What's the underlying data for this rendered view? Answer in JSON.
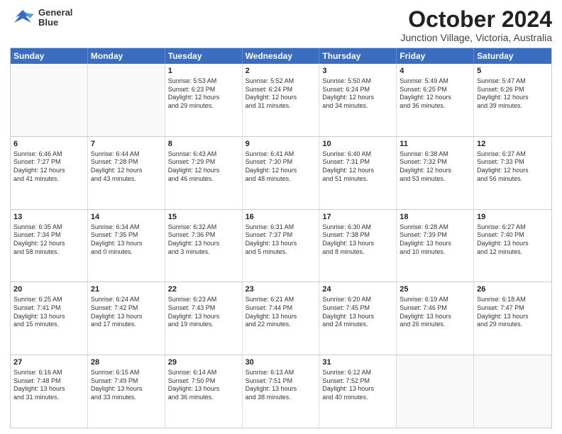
{
  "header": {
    "logo": {
      "line1": "General",
      "line2": "Blue"
    },
    "title": "October 2024",
    "subtitle": "Junction Village, Victoria, Australia"
  },
  "days_of_week": [
    "Sunday",
    "Monday",
    "Tuesday",
    "Wednesday",
    "Thursday",
    "Friday",
    "Saturday"
  ],
  "weeks": [
    [
      {
        "day": "",
        "info": ""
      },
      {
        "day": "",
        "info": ""
      },
      {
        "day": "1",
        "info": "Sunrise: 5:53 AM\nSunset: 6:23 PM\nDaylight: 12 hours\nand 29 minutes."
      },
      {
        "day": "2",
        "info": "Sunrise: 5:52 AM\nSunset: 6:24 PM\nDaylight: 12 hours\nand 31 minutes."
      },
      {
        "day": "3",
        "info": "Sunrise: 5:50 AM\nSunset: 6:24 PM\nDaylight: 12 hours\nand 34 minutes."
      },
      {
        "day": "4",
        "info": "Sunrise: 5:49 AM\nSunset: 6:25 PM\nDaylight: 12 hours\nand 36 minutes."
      },
      {
        "day": "5",
        "info": "Sunrise: 5:47 AM\nSunset: 6:26 PM\nDaylight: 12 hours\nand 39 minutes."
      }
    ],
    [
      {
        "day": "6",
        "info": "Sunrise: 6:46 AM\nSunset: 7:27 PM\nDaylight: 12 hours\nand 41 minutes."
      },
      {
        "day": "7",
        "info": "Sunrise: 6:44 AM\nSunset: 7:28 PM\nDaylight: 12 hours\nand 43 minutes."
      },
      {
        "day": "8",
        "info": "Sunrise: 6:43 AM\nSunset: 7:29 PM\nDaylight: 12 hours\nand 46 minutes."
      },
      {
        "day": "9",
        "info": "Sunrise: 6:41 AM\nSunset: 7:30 PM\nDaylight: 12 hours\nand 48 minutes."
      },
      {
        "day": "10",
        "info": "Sunrise: 6:40 AM\nSunset: 7:31 PM\nDaylight: 12 hours\nand 51 minutes."
      },
      {
        "day": "11",
        "info": "Sunrise: 6:38 AM\nSunset: 7:32 PM\nDaylight: 12 hours\nand 53 minutes."
      },
      {
        "day": "12",
        "info": "Sunrise: 6:37 AM\nSunset: 7:33 PM\nDaylight: 12 hours\nand 56 minutes."
      }
    ],
    [
      {
        "day": "13",
        "info": "Sunrise: 6:35 AM\nSunset: 7:34 PM\nDaylight: 12 hours\nand 58 minutes."
      },
      {
        "day": "14",
        "info": "Sunrise: 6:34 AM\nSunset: 7:35 PM\nDaylight: 13 hours\nand 0 minutes."
      },
      {
        "day": "15",
        "info": "Sunrise: 6:32 AM\nSunset: 7:36 PM\nDaylight: 13 hours\nand 3 minutes."
      },
      {
        "day": "16",
        "info": "Sunrise: 6:31 AM\nSunset: 7:37 PM\nDaylight: 13 hours\nand 5 minutes."
      },
      {
        "day": "17",
        "info": "Sunrise: 6:30 AM\nSunset: 7:38 PM\nDaylight: 13 hours\nand 8 minutes."
      },
      {
        "day": "18",
        "info": "Sunrise: 6:28 AM\nSunset: 7:39 PM\nDaylight: 13 hours\nand 10 minutes."
      },
      {
        "day": "19",
        "info": "Sunrise: 6:27 AM\nSunset: 7:40 PM\nDaylight: 13 hours\nand 12 minutes."
      }
    ],
    [
      {
        "day": "20",
        "info": "Sunrise: 6:25 AM\nSunset: 7:41 PM\nDaylight: 13 hours\nand 15 minutes."
      },
      {
        "day": "21",
        "info": "Sunrise: 6:24 AM\nSunset: 7:42 PM\nDaylight: 13 hours\nand 17 minutes."
      },
      {
        "day": "22",
        "info": "Sunrise: 6:23 AM\nSunset: 7:43 PM\nDaylight: 13 hours\nand 19 minutes."
      },
      {
        "day": "23",
        "info": "Sunrise: 6:21 AM\nSunset: 7:44 PM\nDaylight: 13 hours\nand 22 minutes."
      },
      {
        "day": "24",
        "info": "Sunrise: 6:20 AM\nSunset: 7:45 PM\nDaylight: 13 hours\nand 24 minutes."
      },
      {
        "day": "25",
        "info": "Sunrise: 6:19 AM\nSunset: 7:46 PM\nDaylight: 13 hours\nand 26 minutes."
      },
      {
        "day": "26",
        "info": "Sunrise: 6:18 AM\nSunset: 7:47 PM\nDaylight: 13 hours\nand 29 minutes."
      }
    ],
    [
      {
        "day": "27",
        "info": "Sunrise: 6:16 AM\nSunset: 7:48 PM\nDaylight: 13 hours\nand 31 minutes."
      },
      {
        "day": "28",
        "info": "Sunrise: 6:15 AM\nSunset: 7:49 PM\nDaylight: 13 hours\nand 33 minutes."
      },
      {
        "day": "29",
        "info": "Sunrise: 6:14 AM\nSunset: 7:50 PM\nDaylight: 13 hours\nand 36 minutes."
      },
      {
        "day": "30",
        "info": "Sunrise: 6:13 AM\nSunset: 7:51 PM\nDaylight: 13 hours\nand 38 minutes."
      },
      {
        "day": "31",
        "info": "Sunrise: 6:12 AM\nSunset: 7:52 PM\nDaylight: 13 hours\nand 40 minutes."
      },
      {
        "day": "",
        "info": ""
      },
      {
        "day": "",
        "info": ""
      }
    ]
  ]
}
